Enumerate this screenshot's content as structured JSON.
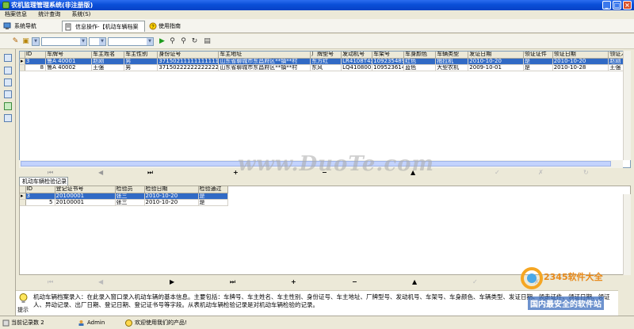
{
  "window": {
    "title": "农机监理管理系统(非注册版)",
    "min": "_",
    "max": "□",
    "close": "×"
  },
  "menu": [
    "档案信息",
    "统计查询",
    "系统(S)"
  ],
  "tabs": {
    "nav": "系统导航",
    "active": "信息操作-【机动车辆档案录入】",
    "close": "×",
    "help": "使用指南"
  },
  "main_grid": {
    "columns": [
      "ID",
      "车牌号",
      "车主姓名",
      "车主性别",
      "身份证号",
      "车主地址",
      "厂牌型号",
      "发动机号",
      "车架号",
      "车身颜色",
      "车辆类型",
      "发证日期",
      "领证证件",
      "领证日期",
      "领证人"
    ],
    "rows": [
      [
        "3",
        "鲁A 40001",
        "赵刚",
        "男",
        "371502111111111111",
        "山东省聊城市东昌府区**镇**村",
        "东方红",
        "LR4108T4X",
        "109235489",
        "红色",
        "拖拉机",
        "2010-10-20",
        "是",
        "2010-10-20",
        "赵刚"
      ],
      [
        "8",
        "鲁A 40002",
        "王强",
        "男",
        "371502222222222222",
        "山东省聊城市东昌府区**镇**村",
        "东风",
        "LQ4108001",
        "109523614",
        "蓝色",
        "大型农机",
        "2009-10-01",
        "是",
        "2010-10-28",
        "王强"
      ]
    ]
  },
  "nav_symbols": [
    "⏮",
    "◀",
    "▶",
    "⏭",
    "+",
    "−",
    "▲",
    "✓",
    "✗",
    "↻"
  ],
  "watermark": "www.DuoTe.com",
  "sub_tab": "机动车辆检验记录",
  "sub_grid": {
    "columns": [
      "ID",
      "登记证书号",
      "检验员",
      "检验日期",
      "检验通过"
    ],
    "rows": [
      [
        "3",
        "20100001",
        "张三",
        "2010-10-20",
        "是"
      ],
      [
        "5",
        "20100001",
        "张三",
        "2010-10-20",
        "是"
      ]
    ]
  },
  "hint": {
    "label": "提示",
    "text": "机动车辆档案录入：在此录入窗口录入机动车辆的基本信息。主要包括：车牌号、车主姓名、车主性别、身份证号、车主地址、厂牌型号、发动机号、车架号、车身颜色、车辆类型、发证日期、领走证件、领证日期、领证人、异动记录、出厂日期、登记日期、登记证书号等字段。从表机动车辆检验记录是对机动车辆检验的记录。"
  },
  "status": {
    "records": "当前记录数 2",
    "user": "Admin",
    "welcome": "欢迎使用我们的产品!"
  },
  "logo": {
    "brand": "2345软件大全",
    "slogan": "国内最安全的软件站"
  },
  "colors": {
    "titlebar": "#0a4fd8",
    "selection": "#316ac5",
    "face": "#ece9d8"
  }
}
